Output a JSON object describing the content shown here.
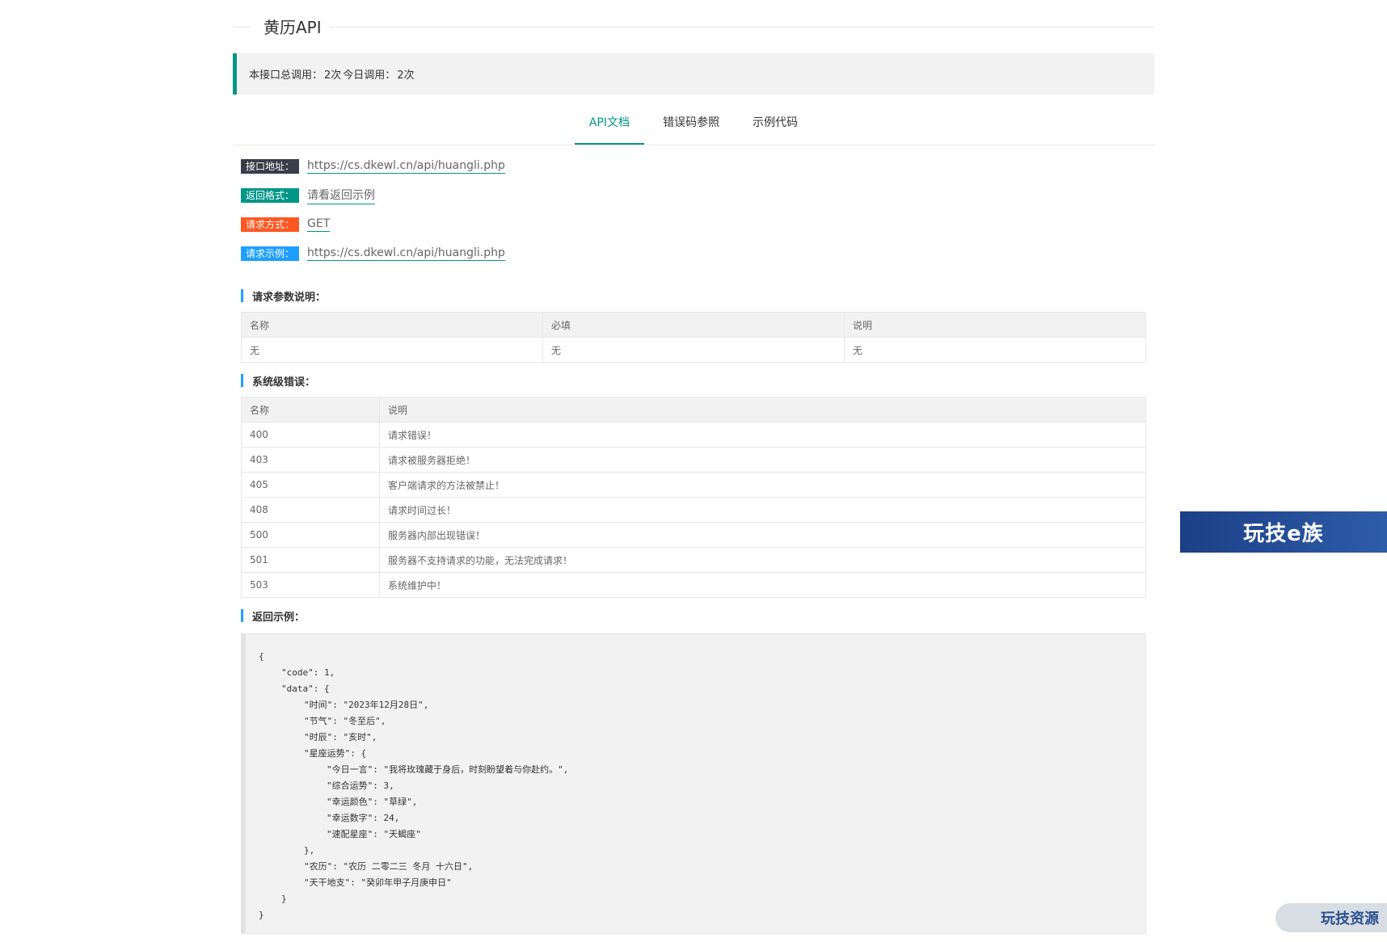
{
  "header": {
    "title": "黄历API"
  },
  "stats": {
    "total_label": "本接口总调用：",
    "total_value": "2次",
    "today_label": "今日调用：",
    "today_value": "2次"
  },
  "tabs": [
    {
      "label": "API文档",
      "active": true
    },
    {
      "label": "错误码参照",
      "active": false
    },
    {
      "label": "示例代码",
      "active": false
    }
  ],
  "info": [
    {
      "badge": "接口地址：",
      "value": "https://cs.dkewl.cn/api/huangli.php"
    },
    {
      "badge": "返回格式：",
      "value": "请看返回示例"
    },
    {
      "badge": "请求方式：",
      "value": "GET"
    },
    {
      "badge": "请求示例：",
      "value": "https://cs.dkewl.cn/api/huangli.php"
    }
  ],
  "params": {
    "heading": "请求参数说明：",
    "headers": [
      "名称",
      "必填",
      "说明"
    ],
    "rows": [
      [
        "无",
        "无",
        "无"
      ]
    ]
  },
  "errors": {
    "heading": "系统级错误：",
    "headers": [
      "名称",
      "说明"
    ],
    "rows": [
      [
        "400",
        "请求错误！"
      ],
      [
        "403",
        "请求被服务器拒绝！"
      ],
      [
        "405",
        "客户端请求的方法被禁止！"
      ],
      [
        "408",
        "请求时间过长！"
      ],
      [
        "500",
        "服务器内部出现错误！"
      ],
      [
        "501",
        "服务器不支持请求的功能，无法完成请求！"
      ],
      [
        "503",
        "系统维护中！"
      ]
    ]
  },
  "example": {
    "heading": "返回示例：",
    "lines": [
      "{",
      "\"code\": 1,",
      "\"data\": {",
      "\"时间\": \"2023年12月28日\",",
      "\"节气\": \"冬至后\",",
      "\"时辰\": \"亥时\",",
      "\"星座运势\": {",
      "\"今日一言\": \"我将玫瑰藏于身后，时刻盼望着与你赴约。\",",
      "\"综合运势\": 3,",
      "\"幸运颜色\": \"草绿\",",
      "\"幸运数字\": 24,",
      "\"速配星座\": \"天蝎座\"",
      "},",
      "\"农历\": \"农历 二零二三 冬月 十六日\",",
      "\"天干地支\": \"癸卯年甲子月庚申日\"",
      "}",
      "}"
    ],
    "indents": [
      0,
      1,
      1,
      2,
      2,
      2,
      2,
      3,
      3,
      3,
      3,
      3,
      2,
      2,
      2,
      1,
      0
    ]
  },
  "widgets": {
    "banner": "玩技e族",
    "pill": "玩技资源"
  }
}
